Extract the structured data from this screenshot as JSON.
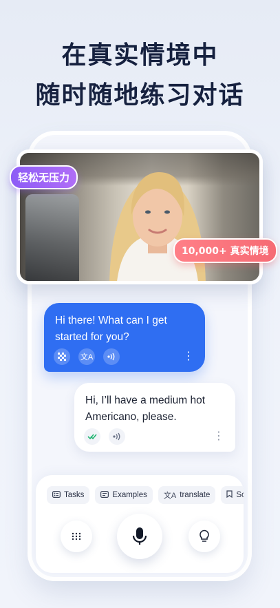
{
  "headline": {
    "line1": "在真实情境中",
    "line2": "随时随地练习对话"
  },
  "tags": {
    "stress_free": "轻松无压力",
    "scenarios": "10,000+ 真实情境"
  },
  "messages": [
    {
      "role": "assistant",
      "text": "Hi there! What can I get started for you?"
    },
    {
      "role": "user",
      "text": "Hi, I’ll have a medium hot Americano, please."
    }
  ],
  "chips": [
    {
      "label": "Tasks",
      "icon": "tasks-icon"
    },
    {
      "label": "Examples",
      "icon": "examples-icon"
    },
    {
      "label": "translate",
      "icon": "translate-icon"
    },
    {
      "label": "Sc",
      "icon": "bookmark-icon"
    }
  ],
  "icons": {
    "more": "⋮",
    "translate_glyph": "文A",
    "keyboard": "keyboard-icon",
    "mic": "mic-icon",
    "hint": "lightbulb-icon"
  },
  "colors": {
    "accent": "#2f6ef2",
    "tag_purple": "#9b63f7",
    "tag_pink": "#f66b74",
    "check_green": "#22b573"
  }
}
